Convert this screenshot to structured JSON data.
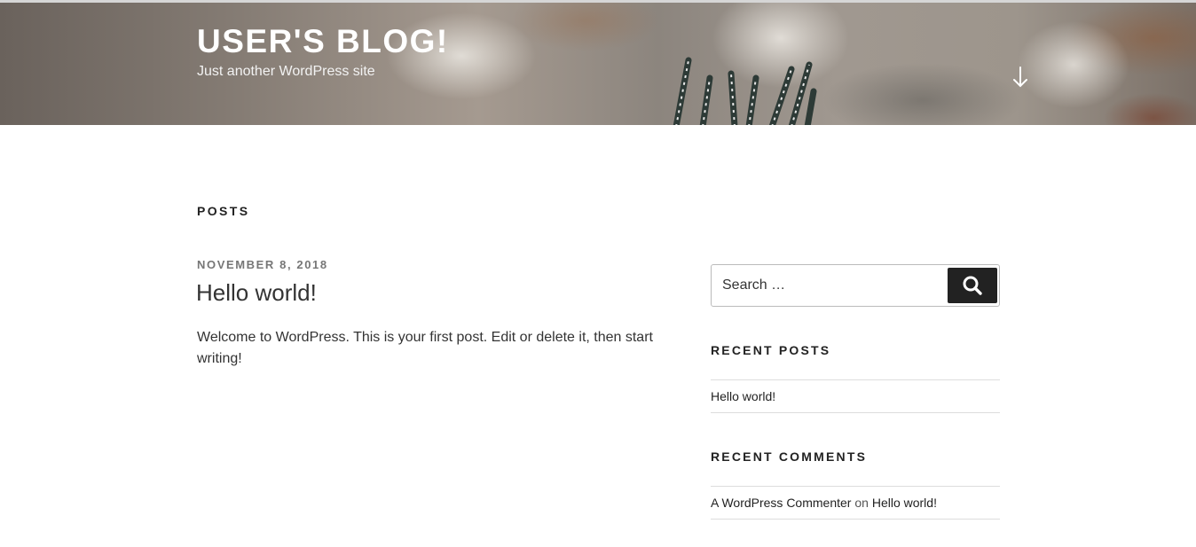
{
  "site": {
    "title": "USER'S BLOG!",
    "description": "Just another WordPress site"
  },
  "header": {
    "scroll_icon": "arrow-down-icon"
  },
  "main": {
    "heading": "POSTS",
    "post": {
      "date": "NOVEMBER 8, 2018",
      "title": "Hello world!",
      "excerpt": "Welcome to WordPress. This is your first post. Edit or delete it, then start writing!"
    }
  },
  "sidebar": {
    "search": {
      "placeholder": "Search …",
      "button_icon": "search-icon"
    },
    "recent_posts": {
      "title": "RECENT POSTS",
      "items": [
        {
          "label": "Hello world!"
        }
      ]
    },
    "recent_comments": {
      "title": "RECENT COMMENTS",
      "items": [
        {
          "author": "A WordPress Commenter",
          "connector": "on",
          "post": "Hello world!"
        }
      ]
    }
  },
  "colors": {
    "text": "#333333",
    "heading": "#222222",
    "meta": "#767676",
    "button": "#222222",
    "divider": "#dddddd"
  }
}
